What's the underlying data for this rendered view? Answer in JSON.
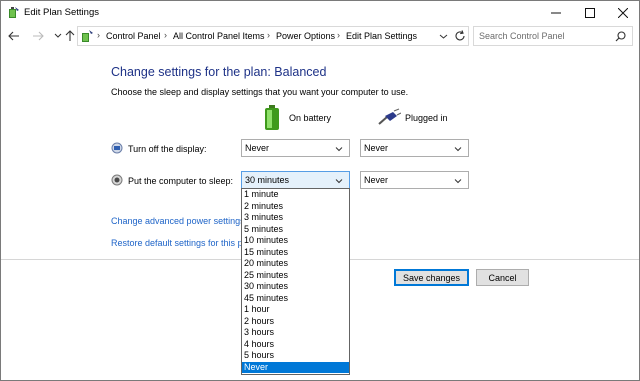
{
  "window": {
    "title": "Edit Plan Settings"
  },
  "address_bar": {
    "crumbs": [
      "Control Panel",
      "All Control Panel Items",
      "Power Options",
      "Edit Plan Settings"
    ],
    "search_placeholder": "Search Control Panel"
  },
  "main": {
    "heading": "Change settings for the plan: Balanced",
    "description": "Choose the sleep and display settings that you want your computer to use.",
    "columns": {
      "battery": "On battery",
      "plugged": "Plugged in"
    },
    "rows": [
      {
        "label": "Turn off the display:",
        "battery_value": "Never",
        "plugged_value": "Never"
      },
      {
        "label": "Put the computer to sleep:",
        "battery_value": "30 minutes",
        "plugged_value": "Never"
      }
    ],
    "links": {
      "advanced": "Change advanced power settings",
      "restore": "Restore default settings for this pl"
    }
  },
  "footer": {
    "save_label": "Save changes",
    "cancel_label": "Cancel"
  },
  "dropdown": {
    "options": [
      "1 minute",
      "2 minutes",
      "3 minutes",
      "5 minutes",
      "10 minutes",
      "15 minutes",
      "20 minutes",
      "25 minutes",
      "30 minutes",
      "45 minutes",
      "1 hour",
      "2 hours",
      "3 hours",
      "4 hours",
      "5 hours",
      "Never"
    ],
    "highlighted": "Never"
  },
  "colors": {
    "heading": "#1e3287",
    "link": "#1e64c8",
    "accent": "#0078d7"
  }
}
